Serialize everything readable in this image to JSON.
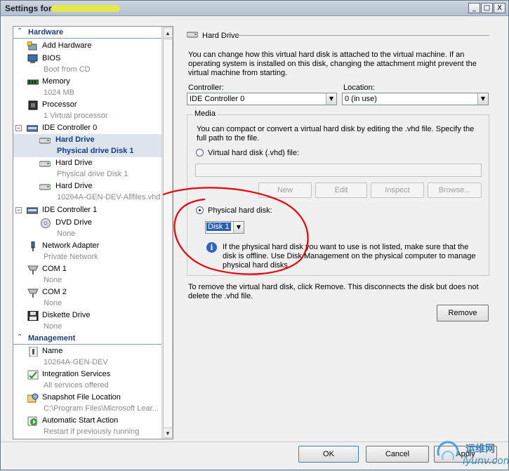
{
  "window": {
    "title": "Settings for",
    "minimize": "_",
    "maximize": "□",
    "close": "X"
  },
  "tree": {
    "hardware_header": "Hardware",
    "management_header": "Management",
    "items": [
      {
        "label": "Add Hardware",
        "sub": ""
      },
      {
        "label": "BIOS",
        "sub": "Boot from CD"
      },
      {
        "label": "Memory",
        "sub": "1024 MB"
      },
      {
        "label": "Processor",
        "sub": "1 Virtual processor"
      },
      {
        "label": "IDE Controller 0",
        "sub": ""
      },
      {
        "label": "Hard Drive",
        "sub": "Physical  drive Disk 1"
      },
      {
        "label": "Hard Drive",
        "sub": "Physical  drive Disk 1"
      },
      {
        "label": "Hard Drive",
        "sub": "10264A-GEN-DEV-Allfiles.vhd"
      },
      {
        "label": "IDE Controller 1",
        "sub": ""
      },
      {
        "label": "DVD Drive",
        "sub": "None"
      },
      {
        "label": "Network Adapter",
        "sub": "Private Network"
      },
      {
        "label": "COM 1",
        "sub": "None"
      },
      {
        "label": "COM 2",
        "sub": "None"
      },
      {
        "label": "Diskette Drive",
        "sub": "None"
      },
      {
        "label": "Name",
        "sub": "10264A-GEN-DEV"
      },
      {
        "label": "Integration Services",
        "sub": "All services offered"
      },
      {
        "label": "Snapshot File Location",
        "sub": "C:\\Program Files\\Microsoft Lear..."
      },
      {
        "label": "Automatic Start Action",
        "sub": "Restart if previously running"
      }
    ]
  },
  "panel": {
    "header": "Hard Drive",
    "description_lines": [
      "You can change how this virtual hard disk is attached to the virtual machine. If an",
      "operating system is installed on this disk, changing the attachment might prevent the",
      "virtual machine from starting."
    ],
    "controller_label": "Controller:",
    "controller_value": "IDE Controller 0",
    "location_label": "Location:",
    "location_value": "0 (in use)",
    "media_label": "Media",
    "media_desc_lines": [
      "You can compact or convert a virtual hard disk by editing the .vhd file. Specify the",
      "full path to the file."
    ],
    "vhd_radio_label": "Virtual hard disk (.vhd) file:",
    "btn_new": "New",
    "btn_edit": "Edit",
    "btn_inspect": "Inspect",
    "btn_browse": "Browse...",
    "physical_radio_label": "Physical hard disk:",
    "disk_value": "Disk 1",
    "info_lines": [
      "If the physical hard disk you want to use is not listed, make sure that the",
      "disk is offline. Use Disk Management on the physical computer to manage",
      "physical hard disks."
    ],
    "remove_lines": [
      "To remove the virtual hard disk, click Remove. This disconnects the disk but does not",
      "delete the .vhd file."
    ],
    "btn_remove": "Remove"
  },
  "footer": {
    "ok": "OK",
    "cancel": "Cancel",
    "apply": "Apply"
  },
  "watermark": {
    "cn": "运维网",
    "url": "iyunv.com"
  },
  "colors": {
    "annotation_red": "#e8000b",
    "selection": "#dde4ec",
    "section_text": "#1e3f78"
  }
}
